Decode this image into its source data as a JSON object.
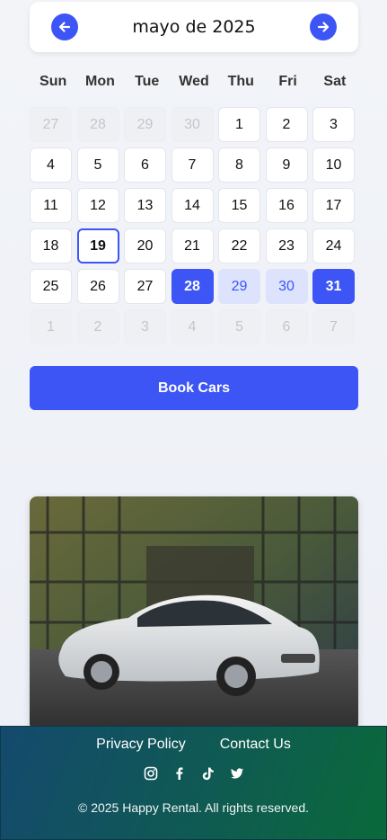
{
  "calendar": {
    "month_label": "mayo de 2025",
    "weekdays": [
      "Sun",
      "Mon",
      "Tue",
      "Wed",
      "Thu",
      "Fri",
      "Sat"
    ],
    "days": [
      {
        "label": "27",
        "state": "out"
      },
      {
        "label": "28",
        "state": "out"
      },
      {
        "label": "29",
        "state": "out"
      },
      {
        "label": "30",
        "state": "out"
      },
      {
        "label": "1",
        "state": "normal"
      },
      {
        "label": "2",
        "state": "normal"
      },
      {
        "label": "3",
        "state": "normal"
      },
      {
        "label": "4",
        "state": "normal"
      },
      {
        "label": "5",
        "state": "normal"
      },
      {
        "label": "6",
        "state": "normal"
      },
      {
        "label": "7",
        "state": "normal"
      },
      {
        "label": "8",
        "state": "normal"
      },
      {
        "label": "9",
        "state": "normal"
      },
      {
        "label": "10",
        "state": "normal"
      },
      {
        "label": "11",
        "state": "normal"
      },
      {
        "label": "12",
        "state": "normal"
      },
      {
        "label": "13",
        "state": "normal"
      },
      {
        "label": "14",
        "state": "normal"
      },
      {
        "label": "15",
        "state": "normal"
      },
      {
        "label": "16",
        "state": "normal"
      },
      {
        "label": "17",
        "state": "normal"
      },
      {
        "label": "18",
        "state": "normal"
      },
      {
        "label": "19",
        "state": "today"
      },
      {
        "label": "20",
        "state": "normal"
      },
      {
        "label": "21",
        "state": "normal"
      },
      {
        "label": "22",
        "state": "normal"
      },
      {
        "label": "23",
        "state": "normal"
      },
      {
        "label": "24",
        "state": "normal"
      },
      {
        "label": "25",
        "state": "normal"
      },
      {
        "label": "26",
        "state": "normal"
      },
      {
        "label": "27",
        "state": "normal"
      },
      {
        "label": "28",
        "state": "sel"
      },
      {
        "label": "29",
        "state": "range"
      },
      {
        "label": "30",
        "state": "range"
      },
      {
        "label": "31",
        "state": "sel"
      },
      {
        "label": "1",
        "state": "out"
      },
      {
        "label": "2",
        "state": "out"
      },
      {
        "label": "3",
        "state": "out"
      },
      {
        "label": "4",
        "state": "out"
      },
      {
        "label": "5",
        "state": "out"
      },
      {
        "label": "6",
        "state": "out"
      },
      {
        "label": "7",
        "state": "out"
      }
    ]
  },
  "actions": {
    "book_label": "Book Cars"
  },
  "footer": {
    "privacy": "Privacy Policy",
    "contact": "Contact Us",
    "socials": [
      "instagram-icon",
      "facebook-icon",
      "tiktok-icon",
      "twitter-icon"
    ],
    "copyright": "© 2025 Happy Rental. All rights reserved."
  },
  "colors": {
    "accent": "#3d55f5",
    "range": "#dde3fd"
  }
}
